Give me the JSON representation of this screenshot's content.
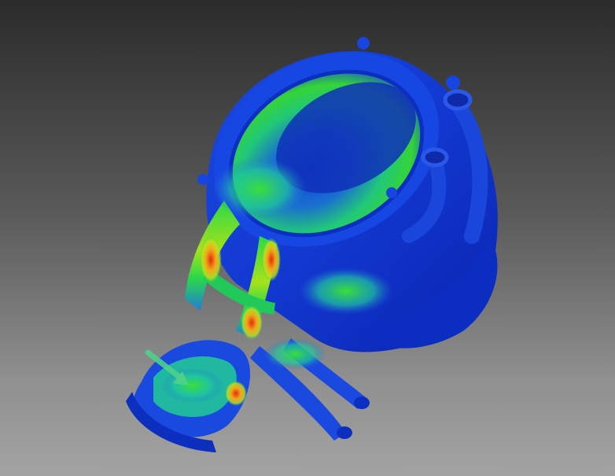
{
  "viewport": {
    "description_colors": {
      "background_top": "#2b2b2b",
      "background_bottom": "#a3a3a3",
      "low_stress": "#0a2fd6",
      "mid_stress": "#1fd64a",
      "high_stress": "#e32a10",
      "load_arrow": "#4fd18a"
    }
  },
  "model": {
    "legend_visible": false,
    "icons": [
      "load-arrow-icon"
    ]
  }
}
